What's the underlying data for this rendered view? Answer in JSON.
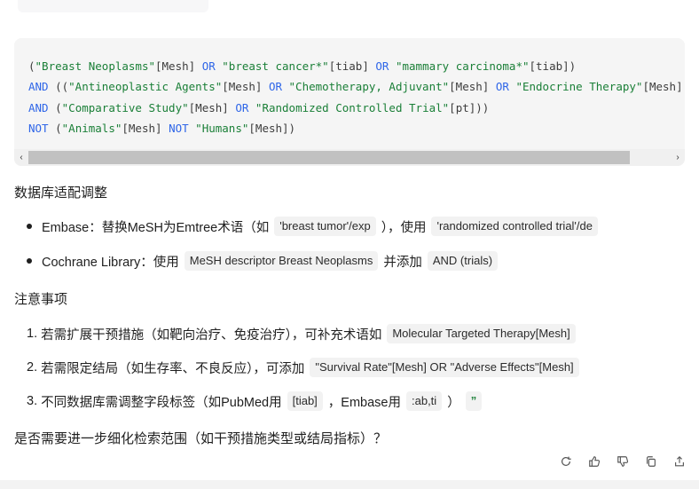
{
  "code": {
    "lines": [
      [
        {
          "t": "(",
          "k": "plain"
        },
        {
          "t": "\"Breast Neoplasms\"",
          "k": "string"
        },
        {
          "t": "[Mesh] ",
          "k": "plain"
        },
        {
          "t": "OR",
          "k": "op"
        },
        {
          "t": " ",
          "k": "plain"
        },
        {
          "t": "\"breast cancer*\"",
          "k": "string"
        },
        {
          "t": "[tiab] ",
          "k": "plain"
        },
        {
          "t": "OR",
          "k": "op"
        },
        {
          "t": " ",
          "k": "plain"
        },
        {
          "t": "\"mammary carcinoma*\"",
          "k": "string"
        },
        {
          "t": "[tiab])",
          "k": "plain"
        }
      ],
      [
        {
          "t": "AND",
          "k": "op"
        },
        {
          "t": " ((",
          "k": "plain"
        },
        {
          "t": "\"Antineoplastic Agents\"",
          "k": "string"
        },
        {
          "t": "[Mesh] ",
          "k": "plain"
        },
        {
          "t": "OR",
          "k": "op"
        },
        {
          "t": " ",
          "k": "plain"
        },
        {
          "t": "\"Chemotherapy, Adjuvant\"",
          "k": "string"
        },
        {
          "t": "[Mesh] ",
          "k": "plain"
        },
        {
          "t": "OR",
          "k": "op"
        },
        {
          "t": " ",
          "k": "plain"
        },
        {
          "t": "\"Endocrine Therapy\"",
          "k": "string"
        },
        {
          "t": "[Mesh]",
          "k": "plain"
        }
      ],
      [
        {
          "t": "AND",
          "k": "op"
        },
        {
          "t": " (",
          "k": "plain"
        },
        {
          "t": "\"Comparative Study\"",
          "k": "string"
        },
        {
          "t": "[Mesh] ",
          "k": "plain"
        },
        {
          "t": "OR",
          "k": "op"
        },
        {
          "t": " ",
          "k": "plain"
        },
        {
          "t": "\"Randomized Controlled Trial\"",
          "k": "string"
        },
        {
          "t": "[pt]))",
          "k": "plain"
        }
      ],
      [
        {
          "t": "NOT",
          "k": "op"
        },
        {
          "t": " (",
          "k": "plain"
        },
        {
          "t": "\"Animals\"",
          "k": "string"
        },
        {
          "t": "[Mesh] ",
          "k": "plain"
        },
        {
          "t": "NOT",
          "k": "op"
        },
        {
          "t": " ",
          "k": "plain"
        },
        {
          "t": "\"Humans\"",
          "k": "string"
        },
        {
          "t": "[Mesh])",
          "k": "plain"
        }
      ]
    ],
    "scroll_left_glyph": "‹",
    "scroll_right_glyph": "›"
  },
  "section1": {
    "title": "数据库适配调整",
    "items": [
      {
        "pre": "Embase：替换MeSH为Emtree术语（如",
        "chip": "'breast tumor'/exp",
        "mid": "），使用",
        "chip2": "'randomized controlled trial'/de"
      },
      {
        "pre": "Cochrane Library：使用",
        "chip": "MeSH descriptor Breast Neoplasms",
        "mid": "并添加",
        "chip2": "AND (trials)"
      }
    ]
  },
  "section2": {
    "title": "注意事项",
    "items": [
      {
        "num": "1.",
        "pre": "若需扩展干预措施（如靶向治疗、免疫治疗），可补充术语如",
        "chip": "Molecular Targeted Therapy[Mesh]"
      },
      {
        "num": "2.",
        "pre": "若需限定结局（如生存率、不良反应），可添加",
        "chip": "\"Survival Rate\"[Mesh] OR \"Adverse Effects\"[Mesh]"
      },
      {
        "num": "3.",
        "pre": "不同数据库需调整字段标签（如PubMed用",
        "chip": "[tiab]",
        "mid": "，Embase用",
        "chip2": ":ab,ti",
        "post": "）",
        "quote": "”"
      }
    ]
  },
  "question": "是否需要进一步细化检索范围（如干预措施类型或结局指标）？",
  "actions": [
    "regenerate-icon",
    "thumbs-up-icon",
    "thumbs-down-icon",
    "copy-icon",
    "share-icon"
  ]
}
